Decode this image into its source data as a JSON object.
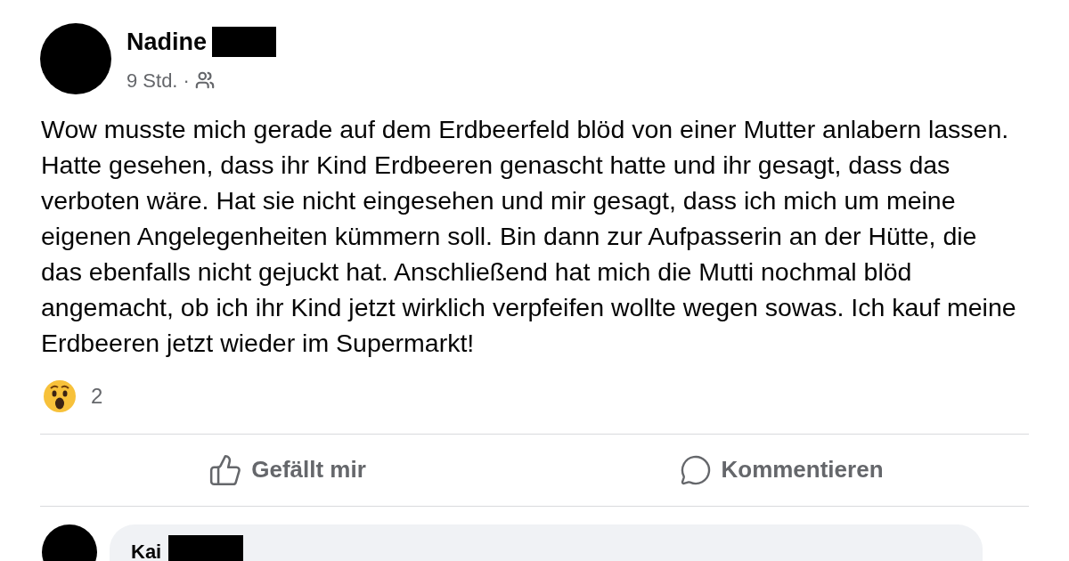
{
  "post": {
    "author": {
      "name": "Nadine"
    },
    "time": "9 Std. ·",
    "text": "Wow musste mich gerade auf dem Erdbeerfeld blöd von einer Mutter anlabern lassen. Hatte gesehen, dass ihr Kind Erdbeeren genascht hatte und ihr gesagt, dass das verboten wäre. Hat sie nicht eingesehen und mir gesagt, dass ich mich um meine eigenen Angelegenheiten kümmern soll. Bin dann zur Aufpasserin an der Hütte, die das ebenfalls nicht gejuckt hat. Anschließend hat mich die Mutti nochmal blöd angemacht, ob ich ihr Kind jetzt wirklich verpfeifen wollte wegen sowas. Ich kauf meine Erdbeeren jetzt wieder im Supermarkt!",
    "reactions": {
      "kind": "wow",
      "count": "2"
    },
    "actions": [
      {
        "kind": "like",
        "label": "Gefällt mir"
      },
      {
        "kind": "comment",
        "label": "Kommentieren"
      }
    ]
  },
  "comments": [
    {
      "author": "Kai"
    }
  ]
}
